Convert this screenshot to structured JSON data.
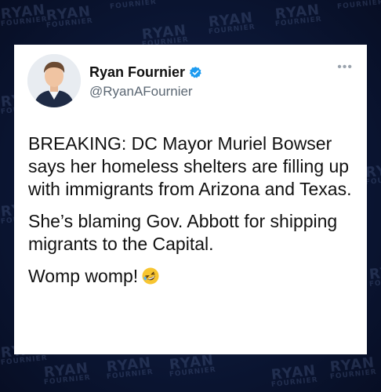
{
  "post": {
    "author_name": "Ryan Fournier",
    "handle": "@RyanAFournier",
    "more_label": "•••",
    "paragraphs": [
      "BREAKING: DC Mayor Muriel Bowser says her homeless shelters are filling up with immigrants from Arizona and Texas.",
      "She’s blaming Gov. Abbott for shipping migrants to the Capital.",
      "Womp womp!"
    ],
    "emoji": "rolling-on-floor-laughing",
    "verified_badge_color": "#1d9bf0"
  },
  "watermark": {
    "line1": "RYAN",
    "line2": "FOURNIER"
  },
  "colors": {
    "background": "#0b1530",
    "card": "#ffffff",
    "text": "#111111",
    "handle": "#5b6773"
  }
}
